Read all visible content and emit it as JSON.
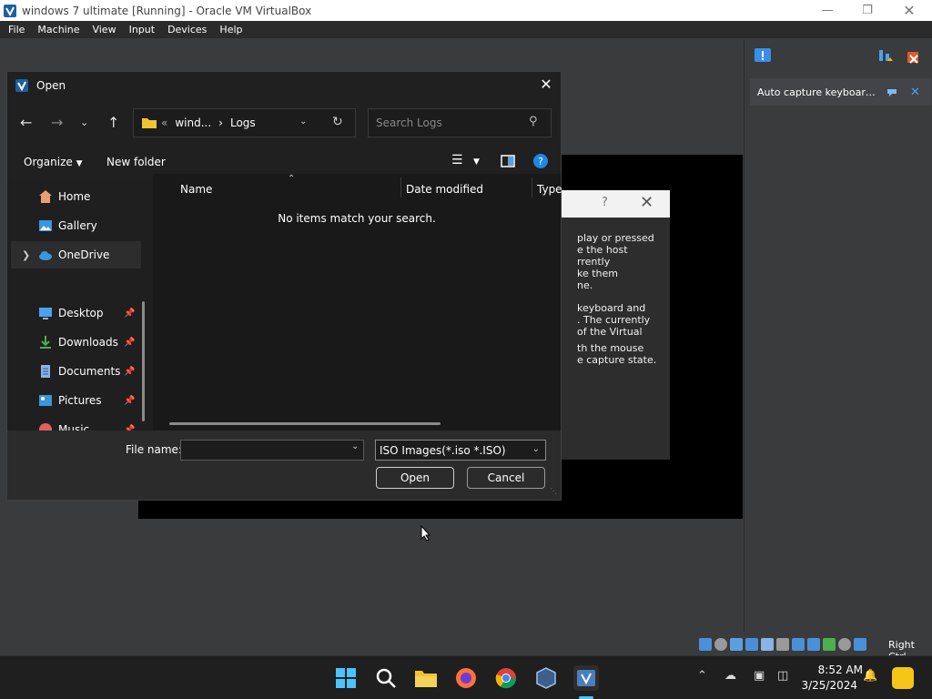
{
  "host_window": {
    "title": "windows 7 ultimate [Running] - Oracle VM VirtualBox",
    "menu": [
      "File",
      "Machine",
      "View",
      "Input",
      "Devices",
      "Help"
    ],
    "host_key": "Right Ctrl"
  },
  "notification_panel": {
    "notice": "Auto capture keyboard ..."
  },
  "guest_dialog": {
    "help": "?",
    "lines_1": "play or pressed\ne the host\nrrently\nke them\nne.",
    "lines_2": "keyboard and\n. The currently\nof the Virtual",
    "lines_3": "th the mouse\ne capture state."
  },
  "open_dialog": {
    "title": "Open",
    "breadcrumb_prefix": "«",
    "breadcrumb_parent": "wind...",
    "breadcrumb_sep": "›",
    "breadcrumb_current": "Logs",
    "search_placeholder": "Search Logs",
    "toolbar": {
      "organize": "Organize",
      "new_folder": "New folder"
    },
    "nav_items": [
      {
        "label": "Home",
        "icon": "home-icon"
      },
      {
        "label": "Gallery",
        "icon": "gallery-icon"
      },
      {
        "label": "OneDrive",
        "icon": "onedrive-icon"
      },
      {
        "label": "Desktop",
        "icon": "desktop-icon"
      },
      {
        "label": "Downloads",
        "icon": "downloads-icon"
      },
      {
        "label": "Documents",
        "icon": "documents-icon"
      },
      {
        "label": "Pictures",
        "icon": "pictures-icon"
      },
      {
        "label": "Music",
        "icon": "music-icon"
      }
    ],
    "columns": {
      "name": "Name",
      "date_modified": "Date modified",
      "type": "Type"
    },
    "empty_message": "No items match your search.",
    "file_name_label": "File name:",
    "file_name_value": "",
    "file_type": "ISO Images(*.iso *.ISO)",
    "open_label": "Open",
    "cancel_label": "Cancel"
  },
  "taskbar": {
    "time": "8:52 AM",
    "date": "3/25/2024"
  },
  "colors": {
    "dialog_bg": "#202020",
    "accent": "#4cc2ff",
    "onedrive": "#3a96dd",
    "folder": "#f1c232"
  }
}
